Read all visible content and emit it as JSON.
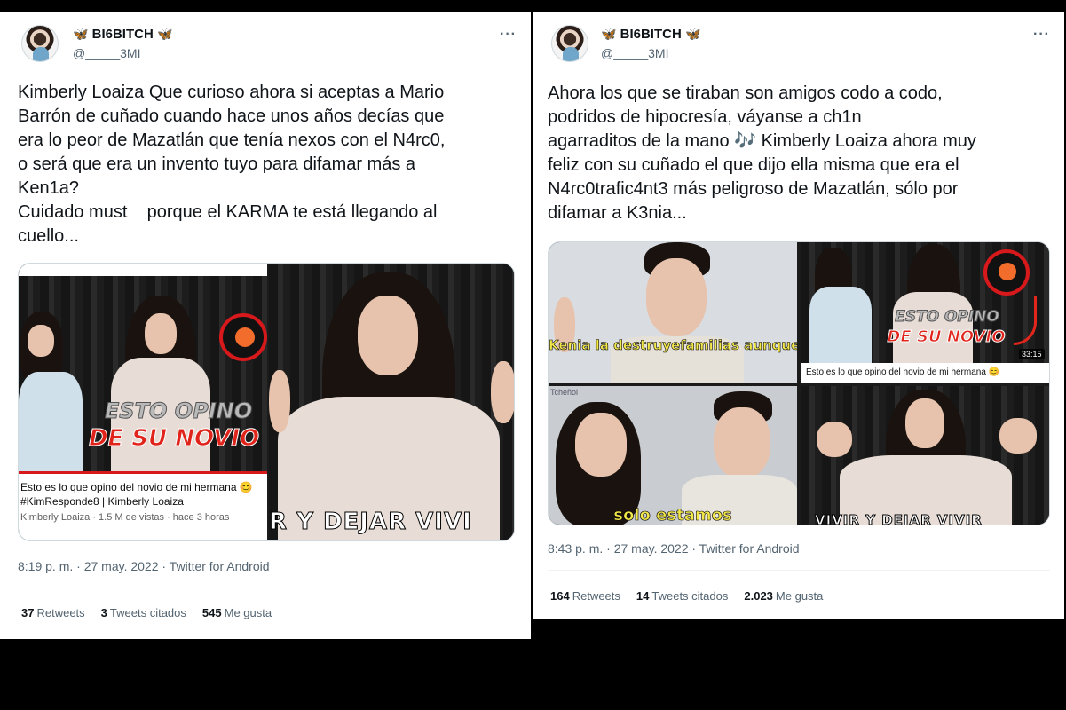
{
  "tweets": [
    {
      "name": "BI6BITCH",
      "handle": "@_____3MI",
      "text": "Kimberly Loaiza Que curioso ahora si aceptas a Mario\nBarrón de cuñado cuando hace unos años decías que\nera lo peor de Mazatlán que tenía nexos con el N4rc0,\no será que era un invento tuyo para difamar más a\nKen1a?\nCuidado must    porque el KARMA te está llegando al\ncuello...",
      "media": {
        "thumb_title_line1": "ESTO OPINO",
        "thumb_title_line2": "DE SU NOVIO",
        "video_title": "Esto es lo que opino del novio de mi hermana 😊",
        "video_tags": "#KimResponde8 | Kimberly Loaiza",
        "video_meta": "Kimberly Loaiza · 1.5 M de vistas · hace 3 horas",
        "frame_caption": "R Y DEJAR VIVI"
      },
      "timestamp": "8:19 p. m. · 27 may. 2022 · Twitter for Android",
      "stats": {
        "retweets": "37",
        "retweets_label": "Retweets",
        "quotes": "3",
        "quotes_label": "Tweets citados",
        "likes": "545",
        "likes_label": "Me gusta"
      }
    },
    {
      "name": "BI6BITCH",
      "handle": "@_____3MI",
      "text": "Ahora los que se tiraban son amigos codo a codo,\npodridos de hipocresía, váyanse a ch1n\nagarraditos de la mano 🎶 Kimberly Loaiza ahora muy\nfeliz con su cuñado el que dijo ella misma que era el\nN4rc0trafic4nt3 más peligroso de Mazatlán, sólo por\ndifamar a K3nia...",
      "media": {
        "caption_top": "Kenia la destruyefamilias\naunque así se escuche mal",
        "caption_bottom": "solo estamos",
        "corner_text": "Tcheñol",
        "thumb_title_line1": "ESTO OPINO",
        "thumb_title_line2": "DE SU NOVIO",
        "duration": "33:15",
        "video_title": "Esto es lo que opino del novio de mi hermana 😊",
        "frame_caption": "VIVIR Y DEJAR VIVIR"
      },
      "timestamp": "8:43 p. m. · 27 may. 2022 · Twitter for Android",
      "stats": {
        "retweets": "164",
        "retweets_label": "Retweets",
        "quotes": "14",
        "quotes_label": "Tweets citados",
        "likes": "2.023",
        "likes_label": "Me gusta"
      }
    }
  ],
  "icons": {
    "butterfly": "🦋",
    "more": "···",
    "verified_decoration": "butterfly-icon"
  },
  "colors": {
    "accent": "#1d9bf0",
    "text": "#0f1419",
    "muted": "#536471",
    "thumb_red": "#e0241b"
  }
}
